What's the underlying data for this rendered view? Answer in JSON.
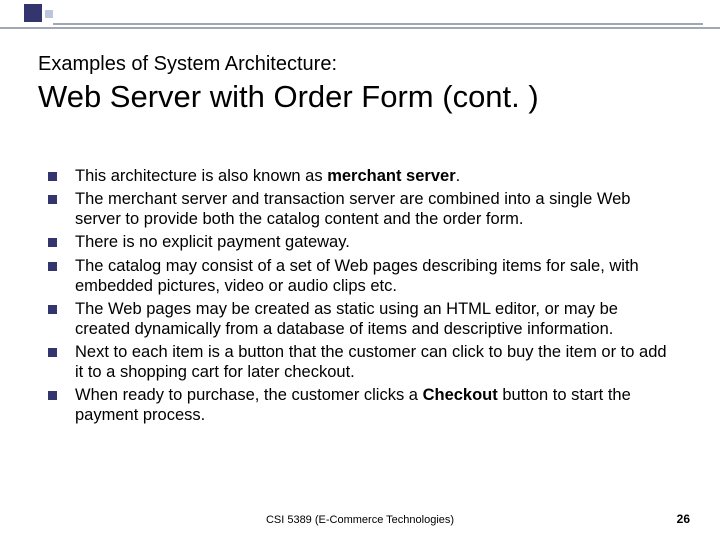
{
  "header": {
    "supertitle": "Examples of System Architecture:",
    "title": "Web Server with Order Form (cont. )"
  },
  "bullets": [
    {
      "pre": "This architecture is also known as ",
      "bold": "merchant server",
      "post": "."
    },
    {
      "text": "The merchant server and transaction server are combined into a single Web server to provide both the catalog content and the order form."
    },
    {
      "text": "There is no explicit payment gateway."
    },
    {
      "text": "The catalog may consist of a set of Web pages describing items for sale, with embedded pictures, video or audio clips etc."
    },
    {
      "text": "The Web pages may be created as static using an HTML editor, or may be created dynamically from a database of items and descriptive information."
    },
    {
      "text": "Next to each item is a button that the customer can click to buy the item or to add it to a shopping cart for later checkout."
    },
    {
      "pre": "When ready to purchase, the customer clicks a ",
      "bold": "Checkout",
      "post": " button to start the payment process."
    }
  ],
  "footer": {
    "course": "CSI 5389 (E-Commerce Technologies)",
    "page": "26"
  }
}
